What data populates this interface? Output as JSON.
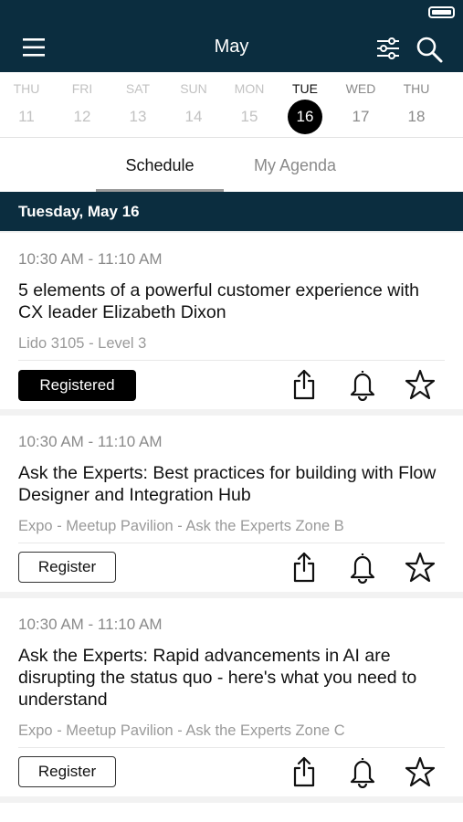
{
  "header": {
    "title": "May"
  },
  "dates": [
    {
      "day": "THU",
      "num": "11",
      "state": "past"
    },
    {
      "day": "FRI",
      "num": "12",
      "state": "past"
    },
    {
      "day": "SAT",
      "num": "13",
      "state": "past"
    },
    {
      "day": "SUN",
      "num": "14",
      "state": "past"
    },
    {
      "day": "MON",
      "num": "15",
      "state": "past"
    },
    {
      "day": "TUE",
      "num": "16",
      "state": "active"
    },
    {
      "day": "WED",
      "num": "17",
      "state": "future"
    },
    {
      "day": "THU",
      "num": "18",
      "state": "future"
    }
  ],
  "tabs": {
    "schedule": "Schedule",
    "agenda": "My Agenda",
    "selected": "schedule"
  },
  "day_header": "Tuesday, May 16",
  "sessions": [
    {
      "time": "10:30 AM - 11:10 AM",
      "title": "5 elements of a powerful customer experience with CX leader Elizabeth Dixon",
      "location": "Lido 3105 - Level 3",
      "button": "Registered",
      "registered": true
    },
    {
      "time": "10:30 AM - 11:10 AM",
      "title": "Ask the Experts: Best practices for building with Flow Designer and Integration Hub",
      "location": "Expo - Meetup Pavilion - Ask the Experts Zone B",
      "button": "Register",
      "registered": false
    },
    {
      "time": "10:30 AM - 11:10 AM",
      "title": "Ask the Experts: Rapid advancements in AI are disrupting the status quo - here's what you need to understand",
      "location": "Expo - Meetup Pavilion - Ask the Experts Zone C",
      "button": "Register",
      "registered": false
    }
  ],
  "colors": {
    "header_bg": "#0b2d3f",
    "accent": "#000000"
  }
}
